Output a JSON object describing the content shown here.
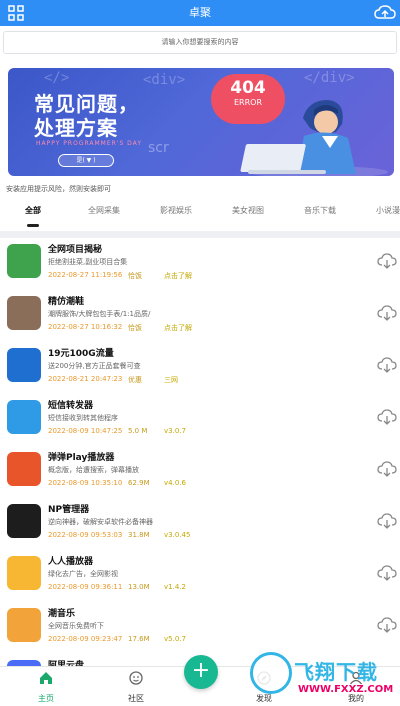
{
  "header": {
    "title": "卓聚"
  },
  "search": {
    "placeholder": "请输入你想要搜索的内容"
  },
  "banner": {
    "line1": "常见问题，",
    "line2": "处理方案",
    "subtitle": "HAPPY PROGRAMMER'S DAY",
    "button": "是( ▼ )",
    "bubble_big": "404",
    "bubble_small": "ERROR",
    "code1": "</>",
    "code2": "<div>",
    "code3": "</div>",
    "scr": "scr"
  },
  "notice": "安装应用提示风险，然则安装即可",
  "tabs": [
    "全部",
    "全网采集",
    "影视娱乐",
    "美女视图",
    "音乐下载",
    "小说漫"
  ],
  "items": [
    {
      "name": "全网项目揭秘",
      "desc": "拒绝割韭菜,副业项目合集",
      "date": "2022-08-27 11:19:56",
      "meta": "恰饭",
      "extra": "点击了解",
      "icon": "android-icon",
      "color": "#3fa34d"
    },
    {
      "name": "精仿潮鞋",
      "desc": "潮牌服饰/大牌包包手表/1:1品质/",
      "date": "2022-08-27 10:16:32",
      "meta": "恰饭",
      "extra": "点击了解",
      "icon": "shoes-icon",
      "color": "#8a6e5a"
    },
    {
      "name": "19元100G流量",
      "desc": "送200分钟,官方正品套餐可查",
      "date": "2022-08-21 20:47:23",
      "meta": "优惠",
      "extra": "三网",
      "icon": "sim-card-icon",
      "color": "#1f6fd1"
    },
    {
      "name": "短信转发器",
      "desc": "短信接收到转其他程序",
      "date": "2022-08-09 10:47:25",
      "meta": "5.0 M",
      "extra": "v3.0.7",
      "icon": "paper-plane-icon",
      "color": "#2f9be6"
    },
    {
      "name": "弹弹Play播放器",
      "desc": "概念版，给遭搜索，弹幕播放",
      "date": "2022-08-09 10:35:10",
      "meta": "62.9M",
      "extra": "v4.0.6",
      "icon": "play-icon",
      "color": "#e8552a"
    },
    {
      "name": "NP管理器",
      "desc": "逆向神器，破解安卓软件必备神器",
      "date": "2022-08-09 09:53:03",
      "meta": "31.8M",
      "extra": "v3.0.45",
      "icon": "android-robot-icon",
      "color": "#1d1d1d"
    },
    {
      "name": "人人播放器",
      "desc": "绿化去广告，全网影视",
      "date": "2022-08-09 09:36:11",
      "meta": "13.0M",
      "extra": "v1.4.2",
      "icon": "bow-icon",
      "color": "#f7b733"
    },
    {
      "name": "潮音乐",
      "desc": "全网音乐免费听下",
      "date": "2022-08-09 09:23:47",
      "meta": "17.6M",
      "extra": "v5.0.7",
      "icon": "toast-icon",
      "color": "#f2a33a"
    },
    {
      "name": "阿里云盘",
      "desc": "",
      "date": "",
      "meta": "",
      "extra": "",
      "icon": "cloud-disk-icon",
      "color": "#4a6cf7"
    }
  ],
  "nav": [
    {
      "label": "主页",
      "icon": "home-icon"
    },
    {
      "label": "社区",
      "icon": "community-icon"
    },
    {
      "label": "发现",
      "icon": "discover-icon"
    },
    {
      "label": "我的",
      "icon": "profile-icon"
    }
  ],
  "fab": "+",
  "watermark": {
    "text1": "飞翔下载",
    "text2": "WWW.FXXZ.COM"
  }
}
